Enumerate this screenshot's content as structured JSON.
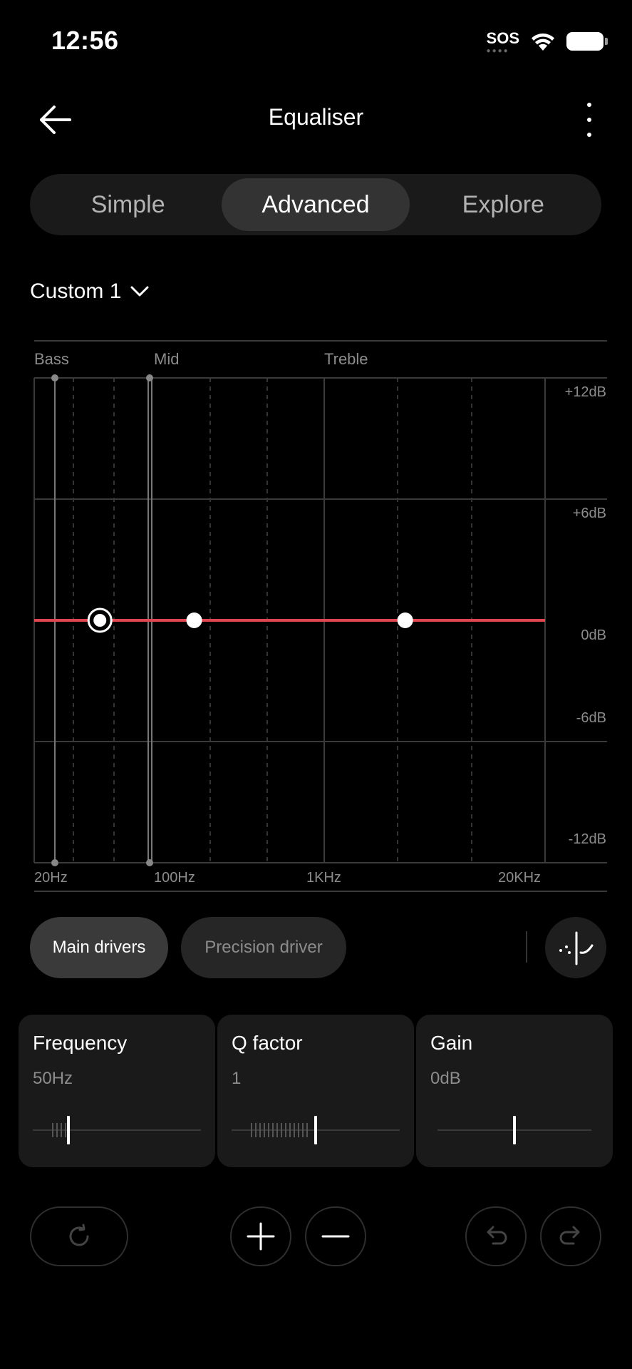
{
  "status": {
    "time": "12:56",
    "sos": "SOS"
  },
  "header": {
    "title": "Equaliser"
  },
  "tabs": [
    {
      "label": "Simple",
      "active": false
    },
    {
      "label": "Advanced",
      "active": true
    },
    {
      "label": "Explore",
      "active": false
    }
  ],
  "preset": {
    "label": "Custom 1"
  },
  "eq_graph": {
    "bands": [
      "Bass",
      "Mid",
      "Treble"
    ],
    "freq_labels": [
      "20Hz",
      "100Hz",
      "1KHz",
      "20KHz"
    ],
    "gain_labels": [
      "+12dB",
      "+6dB",
      "0dB",
      "-6dB",
      "-12dB"
    ],
    "x_range_hz": [
      20,
      20000
    ],
    "y_range_db": [
      -12,
      12
    ],
    "curve_color": "#e0464f",
    "points": [
      {
        "freq_hz": 50,
        "gain_db": 0,
        "selected": true
      },
      {
        "freq_hz": 180,
        "gain_db": 0,
        "selected": false
      },
      {
        "freq_hz": 3000,
        "gain_db": 0,
        "selected": false
      }
    ]
  },
  "drivers": {
    "main": "Main drivers",
    "precision": "Precision driver"
  },
  "params": [
    {
      "label": "Frequency",
      "value": "50Hz",
      "level": 0.2
    },
    {
      "label": "Q factor",
      "value": "1",
      "level": 0.5
    },
    {
      "label": "Gain",
      "value": "0dB",
      "level": 0.5
    }
  ],
  "icons": {
    "back": "arrow-left-icon",
    "more": "more-vertical-icon",
    "preset": "chevron-down-icon",
    "curve": "curve-icon",
    "reset": "reset-icon",
    "add": "plus-icon",
    "remove": "minus-icon",
    "undo": "undo-icon",
    "redo": "redo-icon"
  }
}
